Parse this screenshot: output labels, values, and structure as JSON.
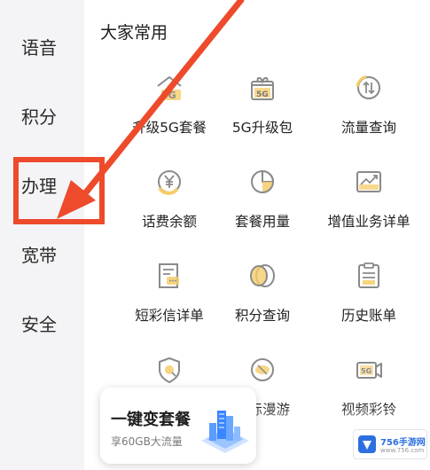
{
  "sidebar": {
    "items": [
      {
        "label": "语音"
      },
      {
        "label": "积分"
      },
      {
        "label": "办理"
      },
      {
        "label": "宽带"
      },
      {
        "label": "安全"
      }
    ]
  },
  "section": {
    "title": "大家常用"
  },
  "grid": {
    "items": [
      {
        "label": "升级5G套餐",
        "icon": "5g-house-icon"
      },
      {
        "label": "5G升级包",
        "icon": "5g-gift-box-icon"
      },
      {
        "label": "流量查询",
        "icon": "data-arrows-icon"
      },
      {
        "label": "话费余额",
        "icon": "yuan-coin-icon"
      },
      {
        "label": "套餐用量",
        "icon": "pie-chart-icon"
      },
      {
        "label": "增值业务详单",
        "icon": "trend-chart-icon"
      },
      {
        "label": "短彩信详单",
        "icon": "sms-document-icon"
      },
      {
        "label": "积分查询",
        "icon": "points-coins-icon"
      },
      {
        "label": "历史账单",
        "icon": "bill-clipboard-icon"
      },
      {
        "label": "",
        "icon": "shield-icon"
      },
      {
        "label": "国际漫游",
        "icon": "roaming-globe-icon"
      },
      {
        "label": "视频彩铃",
        "icon": "5g-video-icon"
      }
    ]
  },
  "promo": {
    "title": "一键变套餐",
    "subtitle": "享60GB大流量"
  },
  "watermark": {
    "brand": "756手游网",
    "url": "www.756.com"
  },
  "colors": {
    "annotation": "#ee4a2c",
    "icon_stroke": "#8a8a8a",
    "icon_accent": "#f6cc6a",
    "sidebar_bg": "#f4f4f6"
  }
}
